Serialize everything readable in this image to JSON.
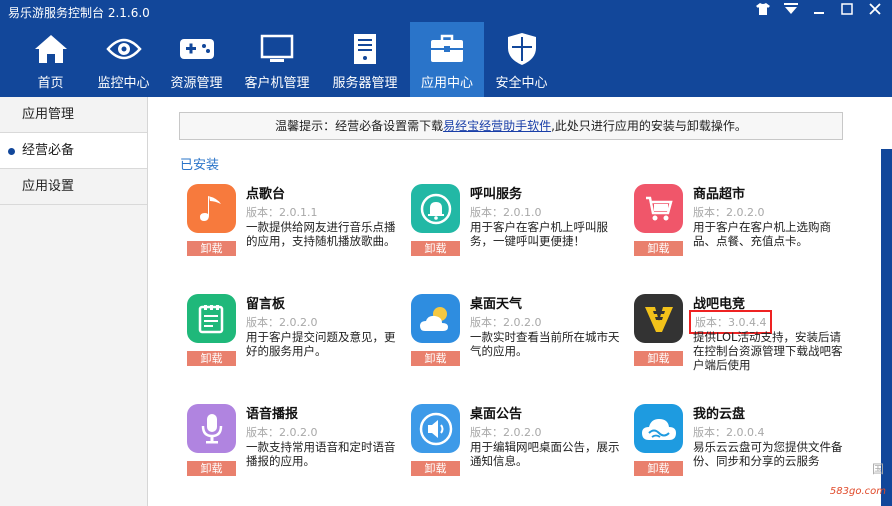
{
  "window": {
    "title": "易乐游服务控制台 2.1.6.0",
    "controls": [
      "skin",
      "menu",
      "minimize",
      "close"
    ]
  },
  "nav": [
    {
      "label": "首页",
      "icon": "home-icon"
    },
    {
      "label": "监控中心",
      "icon": "eye-icon"
    },
    {
      "label": "资源管理",
      "icon": "gamepad-icon"
    },
    {
      "label": "客户机管理",
      "icon": "monitor-icon"
    },
    {
      "label": "服务器管理",
      "icon": "server-icon"
    },
    {
      "label": "应用中心",
      "icon": "toolbox-icon",
      "active": true
    },
    {
      "label": "安全中心",
      "icon": "shield-icon"
    }
  ],
  "sidebar": {
    "items": [
      {
        "label": "应用管理"
      },
      {
        "label": "经营必备",
        "active": true
      },
      {
        "label": "应用设置"
      }
    ]
  },
  "tip": {
    "prefix": "温馨提示：经营必备设置需下载",
    "link": "易经宝经营助手软件",
    "suffix": ",此处只进行应用的安装与卸载操作。"
  },
  "section_title": "已安装",
  "uninstall_label": "卸载",
  "apps": [
    {
      "name": "点歌台",
      "version": "版本：2.0.1.1",
      "desc": "一款提供给网友进行音乐点播的应用，支持随机播放歌曲。",
      "icon": "music-note-icon",
      "color": "#f77a3d"
    },
    {
      "name": "呼叫服务",
      "version": "版本：2.0.1.0",
      "desc": "用于客户在客户机上呼叫服务，一键呼叫更便捷！",
      "icon": "bell-icon",
      "color": "#22b8a5"
    },
    {
      "name": "商品超市",
      "version": "版本：2.0.2.0",
      "desc": "用于客户在客户机上选购商品、点餐、充值点卡。",
      "icon": "cart-icon",
      "color": "#f0566a"
    },
    {
      "name": "留言板",
      "version": "版本：2.0.2.0",
      "desc": "用于客户提交问题及意见，更好的服务用户。",
      "icon": "notepad-icon",
      "color": "#1fb87a"
    },
    {
      "name": "桌面天气",
      "version": "版本：2.0.2.0",
      "desc": "一款实时查看当前所在城市天气的应用。",
      "icon": "weather-icon",
      "color": "#2e8de0"
    },
    {
      "name": "战吧电竞",
      "version": "版本：3.0.4.4",
      "desc": "提供LOL活动支持，安装后请在控制台资源管理下载战吧客户端后使用",
      "icon": "zhanba-logo-icon",
      "color": "#333333"
    },
    {
      "name": "语音播报",
      "version": "版本：2.0.2.0",
      "desc": "一款支持常用语音和定时语音播报的应用。",
      "icon": "microphone-icon",
      "color": "#b084e0"
    },
    {
      "name": "桌面公告",
      "version": "版本：2.0.2.0",
      "desc": "用于编辑网吧桌面公告，展示通知信息。",
      "icon": "speaker-icon",
      "color": "#3d9ae8"
    },
    {
      "name": "我的云盘",
      "version": "版本：2.0.0.4",
      "desc": "易乐云云盘可为您提供文件备份、同步和分享的云服务",
      "icon": "cloud-icon",
      "color": "#1e9be0"
    }
  ],
  "watermark": "583go.com",
  "side_fragment": "国"
}
